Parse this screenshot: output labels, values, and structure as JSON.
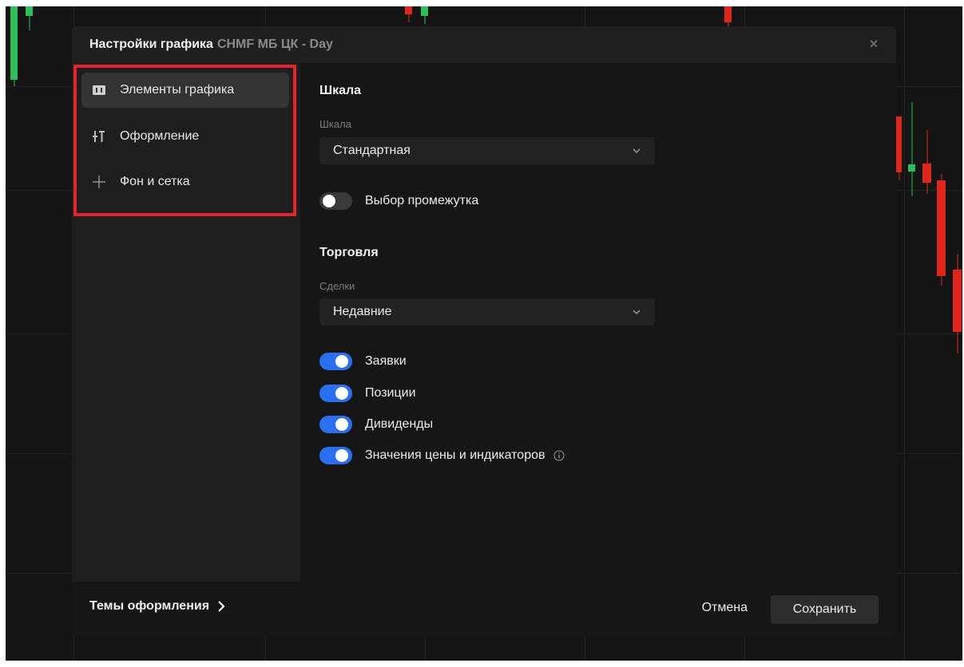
{
  "dialog": {
    "title": "Настройки графика",
    "ticker": "CHMF МБ ЦК - Day",
    "close_symbol": "×"
  },
  "sidebar": {
    "items": [
      {
        "label": "Элементы графика",
        "icon": "chart-elements-icon",
        "active": true
      },
      {
        "label": "Оформление",
        "icon": "appearance-icon",
        "active": false
      },
      {
        "label": "Фон и сетка",
        "icon": "crosshair-grid-icon",
        "active": false
      }
    ]
  },
  "scale": {
    "section_title": "Шкала",
    "field_label": "Шкала",
    "value": "Стандартная",
    "range_toggle_label": "Выбор промежутка",
    "range_toggle_on": false
  },
  "trading": {
    "section_title": "Торговля",
    "field_label": "Сделки",
    "value": "Недавние",
    "toggles": [
      {
        "label": "Заявки",
        "on": true
      },
      {
        "label": "Позиции",
        "on": true
      },
      {
        "label": "Дивиденды",
        "on": true
      },
      {
        "label": "Значения цены и индикаторов",
        "on": true,
        "info": true
      }
    ]
  },
  "footer": {
    "themes_label": "Темы оформления",
    "cancel_label": "Отмена",
    "save_label": "Сохранить"
  },
  "colors": {
    "accent": "#2a6ff0",
    "highlight": "#e8232e",
    "candle_up": "#2dbd5a",
    "candle_down": "#e0261c"
  }
}
